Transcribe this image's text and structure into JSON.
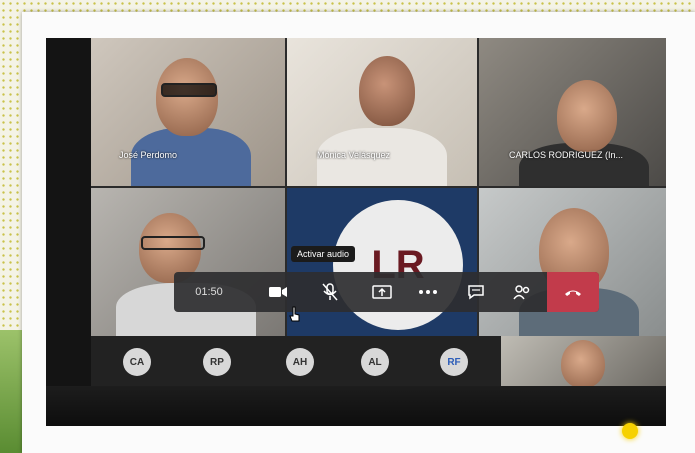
{
  "participants": [
    {
      "name": "José Perdomo"
    },
    {
      "name": "Mónica Velásquez"
    },
    {
      "name": "CARLOS RODRIGUEZ (In..."
    }
  ],
  "active_speaker_initials": "LR",
  "tooltip": "Activar audio",
  "timer": "01:50",
  "toolbar_icons": [
    "camera-icon",
    "mic-off-icon",
    "share-screen-icon",
    "more-icon",
    "chat-icon",
    "people-icon",
    "hang-up-icon"
  ],
  "participant_chips": [
    "CA",
    "RP",
    "AH",
    "AL",
    "RF"
  ],
  "colors": {
    "hangup": "#c23b4b",
    "chip_rf_text": "#2c5db8",
    "initials": "#6a1a22"
  }
}
